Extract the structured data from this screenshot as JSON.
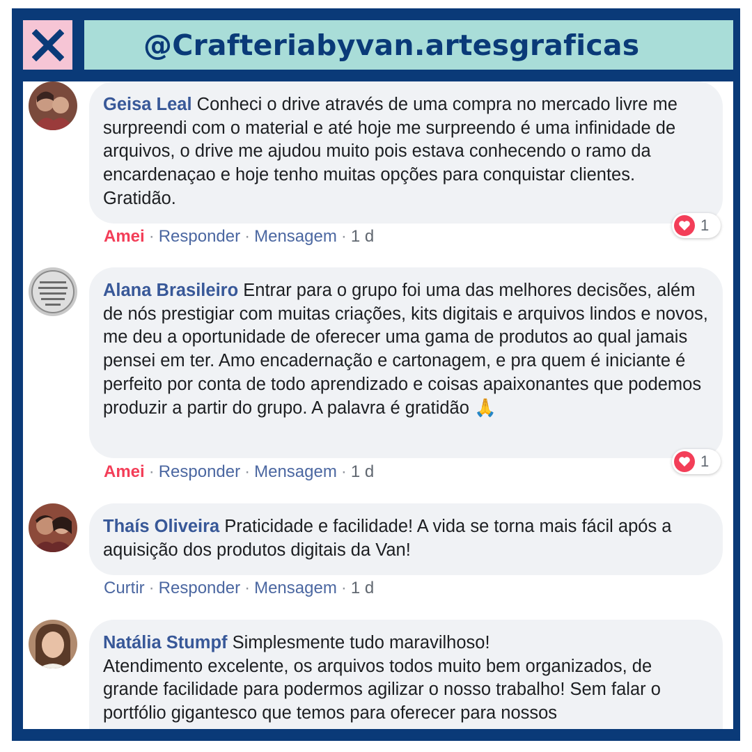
{
  "header": {
    "title": "@Crafteriabyvan.artesgraficas",
    "close_icon": "close-icon"
  },
  "colors": {
    "frame": "#0a3a78",
    "title_bar": "#a9ddd8",
    "close_box": "#f6c5d5",
    "name": "#385898",
    "bubble": "#f0f2f5",
    "love": "#f33e58"
  },
  "comments": [
    {
      "name": "Geisa Leal",
      "text": "Conheci o drive através de uma compra no mercado livre me surpreendi com o material e até hoje me surpreendo é uma infinidade de arquivos, o drive me ajudou muito pois estava conhecendo o ramo da encardenaçao e hoje tenho muitas opções para conquistar clientes. Gratidão.",
      "like_label": "Amei",
      "reply_label": "Responder",
      "message_label": "Mensagem",
      "time": "1 d",
      "reaction_count": "1"
    },
    {
      "name": "Alana Brasileiro",
      "text": "Entrar para o grupo foi uma das melhores decisões, além de nós prestigiar com muitas criações, kits digitais e arquivos lindos e novos, me deu a oportunidade de oferecer uma gama de produtos ao qual jamais pensei em ter. Amo encadernação e cartonagem, e pra quem é iniciante é perfeito por conta de todo aprendizado e coisas apaixonantes que podemos produzir a partir do grupo. A palavra é gratidão 🙏",
      "like_label": "Amei",
      "reply_label": "Responder",
      "message_label": "Mensagem",
      "time": "1 d",
      "reaction_count": "1"
    },
    {
      "name": "Thaís Oliveira",
      "text": "Praticidade e facilidade! A vida se torna mais fácil após a aquisição dos produtos digitais da Van!",
      "like_label": "Curtir",
      "reply_label": "Responder",
      "message_label": "Mensagem",
      "time": "1 d"
    },
    {
      "name": "Natália Stumpf",
      "text": "Simplesmente tudo maravilhoso!",
      "text2": "Atendimento excelente, os arquivos todos muito bem organizados, de grande facilidade para podermos agilizar o nosso trabalho! Sem falar o portfólio gigantesco que temos para oferecer para nossos"
    }
  ]
}
